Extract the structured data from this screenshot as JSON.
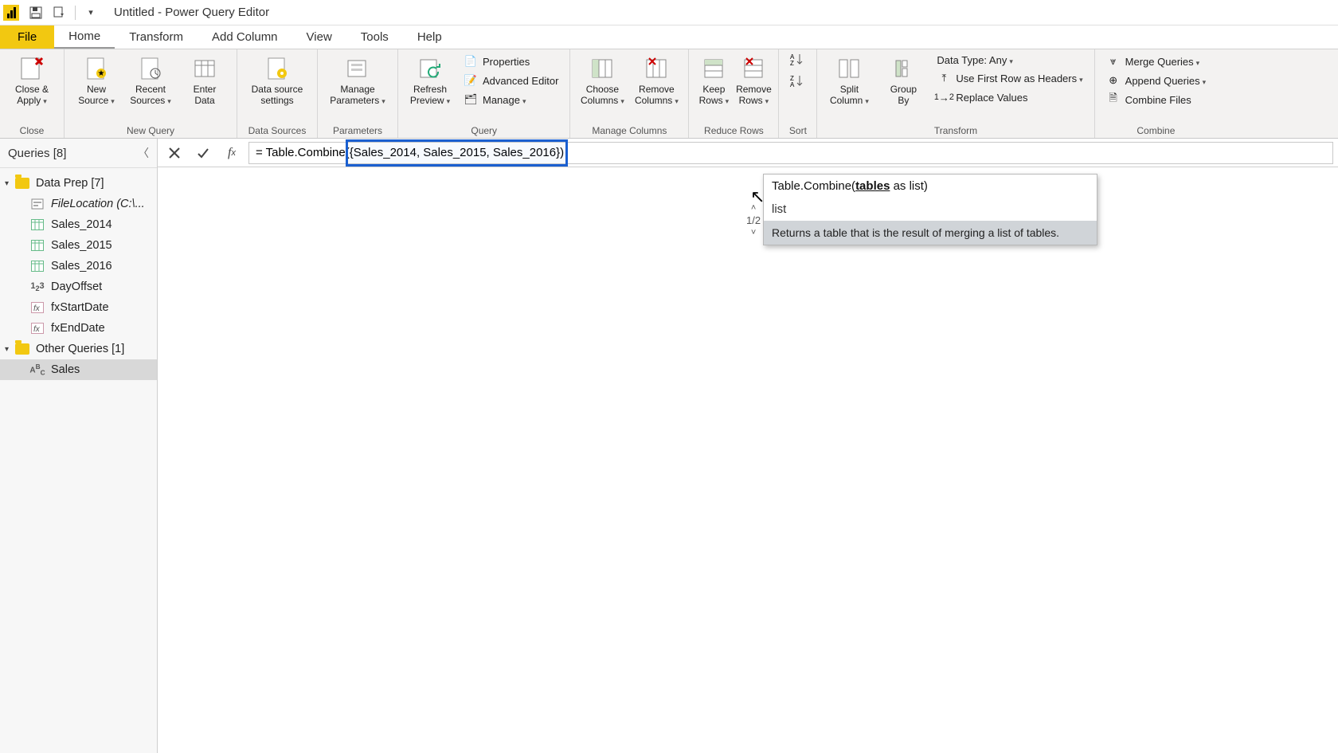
{
  "title": "Untitled - Power Query Editor",
  "menu": {
    "file": "File",
    "home": "Home",
    "transform": "Transform",
    "addcol": "Add Column",
    "view": "View",
    "tools": "Tools",
    "help": "Help"
  },
  "ribbon": {
    "close": {
      "closeApply": "Close &\nApply",
      "group": "Close"
    },
    "newquery": {
      "newSource": "New\nSource",
      "recent": "Recent\nSources",
      "enter": "Enter\nData",
      "group": "New Query"
    },
    "datasources": {
      "settings": "Data source\nsettings",
      "group": "Data Sources"
    },
    "parameters": {
      "manage": "Manage\nParameters",
      "group": "Parameters"
    },
    "query": {
      "refresh": "Refresh\nPreview",
      "properties": "Properties",
      "advEditor": "Advanced Editor",
      "manage": "Manage",
      "group": "Query"
    },
    "cols": {
      "choose": "Choose\nColumns",
      "remove": "Remove\nColumns",
      "group": "Manage Columns"
    },
    "rows": {
      "keep": "Keep\nRows",
      "remove": "Remove\nRows",
      "group": "Reduce Rows"
    },
    "sort": {
      "group": "Sort"
    },
    "transform": {
      "split": "Split\nColumn",
      "group": "Group\nBy",
      "datatype": "Data Type: Any",
      "firstRow": "Use First Row as Headers",
      "replace": "Replace Values",
      "groupLabel": "Transform"
    },
    "combine": {
      "merge": "Merge Queries",
      "append": "Append Queries",
      "combine": "Combine Files",
      "group": "Combine"
    }
  },
  "queriesPane": {
    "title": "Queries [8]",
    "group1": "Data Prep [7]",
    "items1": [
      {
        "label": "FileLocation (C:\\...",
        "kind": "param",
        "italic": true
      },
      {
        "label": "Sales_2014",
        "kind": "table"
      },
      {
        "label": "Sales_2015",
        "kind": "table"
      },
      {
        "label": "Sales_2016",
        "kind": "table"
      },
      {
        "label": "DayOffset",
        "kind": "number"
      },
      {
        "label": "fxStartDate",
        "kind": "fx"
      },
      {
        "label": "fxEndDate",
        "kind": "fx"
      }
    ],
    "group2": "Other Queries [1]",
    "items2": [
      {
        "label": "Sales",
        "kind": "abc",
        "selected": true
      }
    ]
  },
  "formula": {
    "prefix": "= Table.Combine(",
    "highlighted": "{Sales_2014, Sales_2015, Sales_2016}",
    "suffix": ")"
  },
  "tooltip": {
    "sig_pre": "Table.Combine(",
    "sig_param": "tables",
    "sig_post": " as list)",
    "slot": "list",
    "nav": "1/2",
    "desc": "Returns a table that is the result of merging a list of tables."
  }
}
